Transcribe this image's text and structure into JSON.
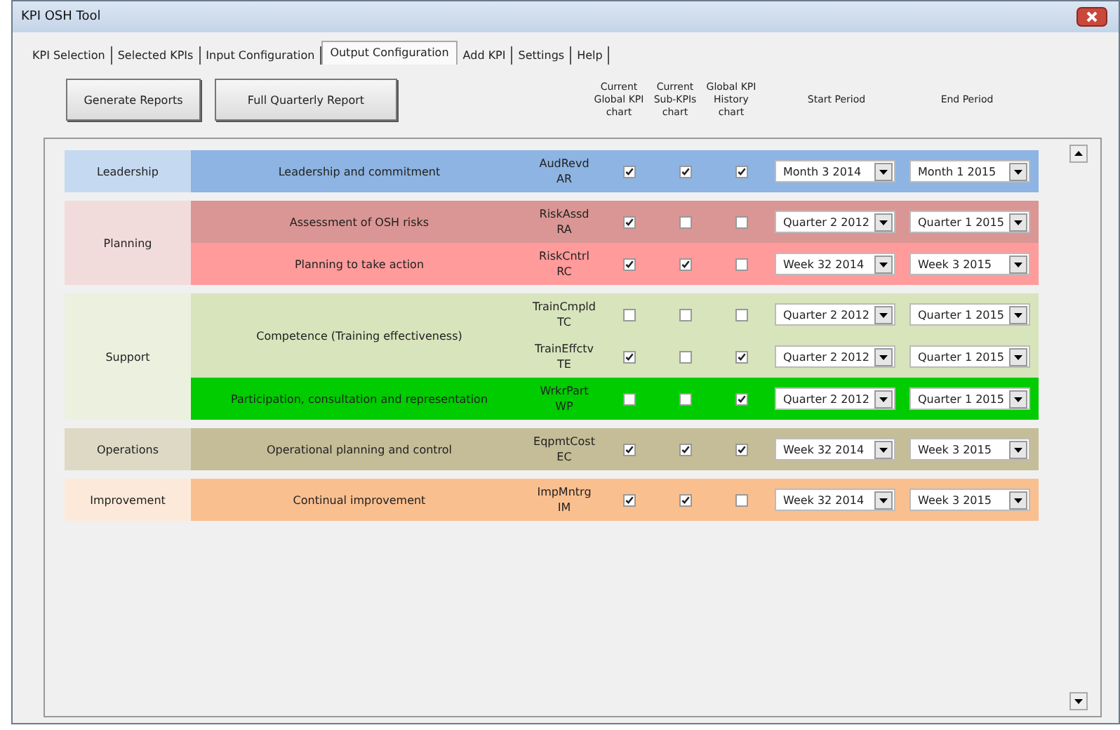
{
  "window": {
    "title": "KPI OSH Tool"
  },
  "tabs": [
    {
      "label": "KPI Selection",
      "selected": false
    },
    {
      "label": "Selected KPIs",
      "selected": false
    },
    {
      "label": "Input Configuration",
      "selected": false
    },
    {
      "label": "Output Configuration",
      "selected": true
    },
    {
      "label": "Add KPI",
      "selected": false
    },
    {
      "label": "Settings",
      "selected": false
    },
    {
      "label": "Help",
      "selected": false
    }
  ],
  "buttons": [
    "Generate Reports",
    "Full Quarterly Report"
  ],
  "column_headers": [
    "Current Global KPI chart",
    "Current Sub-KPIs chart",
    "Global KPI History chart",
    "Start Period",
    "End Period"
  ],
  "groups": [
    {
      "name": "Leadership",
      "color": "#c5d9f1",
      "clauses": [
        {
          "name": "Leadership and commitment",
          "color": "#8db4e2",
          "kpis": [
            {
              "code": "AudRevd",
              "abbr": "AR",
              "checks": [
                true,
                true,
                true
              ],
              "start": "Month 3 2014",
              "end": "Month 1 2015"
            }
          ]
        }
      ]
    },
    {
      "name": "Planning",
      "color": "#f2dcdb",
      "clauses": [
        {
          "name": "Assessment of OSH risks",
          "color": "#da9694",
          "kpis": [
            {
              "code": "RiskAssd",
              "abbr": "RA",
              "checks": [
                true,
                false,
                false
              ],
              "start": "Quarter 2 2012",
              "end": "Quarter 1 2015"
            }
          ]
        },
        {
          "name": "Planning to take action",
          "color": "#ff9b9b",
          "kpis": [
            {
              "code": "RiskCntrl",
              "abbr": "RC",
              "checks": [
                true,
                true,
                false
              ],
              "start": "Week 32 2014",
              "end": "Week 3 2015"
            }
          ]
        }
      ]
    },
    {
      "name": "Support",
      "color": "#ebf1de",
      "clauses": [
        {
          "name": "Competence (Training effectiveness)",
          "color": "#d8e4bc",
          "kpis": [
            {
              "code": "TrainCmpld",
              "abbr": "TC",
              "checks": [
                false,
                false,
                false
              ],
              "start": "Quarter 2 2012",
              "end": "Quarter 1 2015"
            },
            {
              "code": "TrainEffctv",
              "abbr": "TE",
              "checks": [
                true,
                false,
                true
              ],
              "start": "Quarter 2 2012",
              "end": "Quarter 1 2015"
            }
          ]
        },
        {
          "name": "Participation, consultation and representation",
          "color": "#00cc00",
          "kpis": [
            {
              "code": "WrkrPart",
              "abbr": "WP",
              "checks": [
                false,
                false,
                true
              ],
              "start": "Quarter 2 2012",
              "end": "Quarter 1 2015"
            }
          ]
        }
      ]
    },
    {
      "name": "Operations",
      "color": "#ddd9c4",
      "clauses": [
        {
          "name": "Operational planning and control",
          "color": "#c4bd97",
          "kpis": [
            {
              "code": "EqpmtCost",
              "abbr": "EC",
              "checks": [
                true,
                true,
                true
              ],
              "start": "Week 32 2014",
              "end": "Week 3 2015"
            }
          ]
        }
      ]
    },
    {
      "name": "Improvement",
      "color": "#fde9d9",
      "clauses": [
        {
          "name": "Continual improvement",
          "color": "#fabf8f",
          "kpis": [
            {
              "code": "ImpMntrg",
              "abbr": "IM",
              "checks": [
                true,
                true,
                false
              ],
              "start": "Week 32 2014",
              "end": "Week 3 2015"
            }
          ]
        }
      ]
    }
  ]
}
